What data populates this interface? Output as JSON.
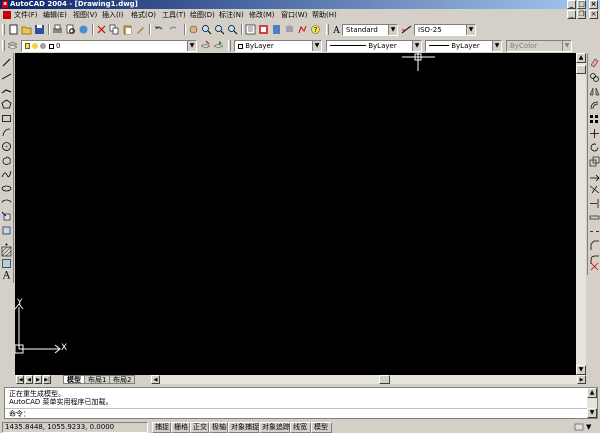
{
  "window": {
    "title": "AutoCAD 2004 - [Drawing1.dwg]",
    "app_icon_glyph": "a"
  },
  "menu": [
    {
      "label": "文件(F)"
    },
    {
      "label": "编辑(E)"
    },
    {
      "label": "视图(V)"
    },
    {
      "label": "插入(I)"
    },
    {
      "label": "格式(O)"
    },
    {
      "label": "工具(T)"
    },
    {
      "label": "绘图(D)"
    },
    {
      "label": "标注(N)"
    },
    {
      "label": "修改(M)"
    },
    {
      "label": "窗口(W)"
    },
    {
      "label": "帮助(H)"
    }
  ],
  "styles": {
    "text_style": "Standard",
    "dim_style": "ISO-25"
  },
  "layer": {
    "current": "0"
  },
  "properties": {
    "color": "ByLayer",
    "linetype": "ByLayer",
    "lineweight": "ByLayer",
    "plotstyle": "ByColor"
  },
  "ucs": {
    "y_label": "Y",
    "x_label": "X"
  },
  "layout_tabs": [
    {
      "label": "模型",
      "active": true
    },
    {
      "label": "布局1",
      "active": false
    },
    {
      "label": "布局2",
      "active": false
    }
  ],
  "command": {
    "history": [
      "正在重生成模型。",
      "AutoCAD 菜单实用程序已加载。"
    ],
    "prompt": "命令："
  },
  "status": {
    "coordinates": "1435.8448, 1055.9233, 0.0000",
    "toggles": [
      "捕捉",
      "栅格",
      "正交",
      "极轴",
      "对象捕捉",
      "对象追踪",
      "线宽",
      "模型"
    ]
  },
  "colors": {
    "canvas": "#000000",
    "chrome": "#d4d0c8",
    "title_start": "#0a246a",
    "title_end": "#a6caf0"
  }
}
